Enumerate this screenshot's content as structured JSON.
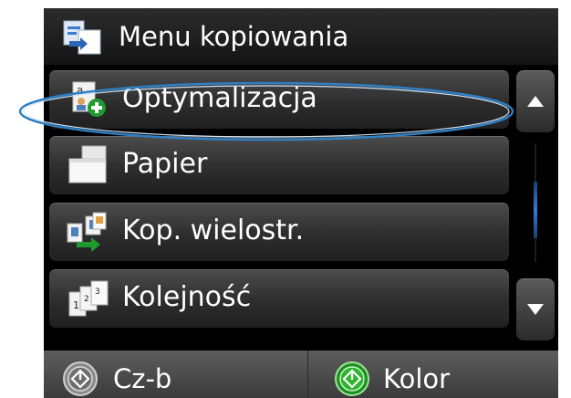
{
  "header": {
    "title": "Menu kopiowania",
    "icon": "copy-icon"
  },
  "menu": {
    "items": [
      {
        "label": "Optymalizacja",
        "icon": "optimize-icon"
      },
      {
        "label": "Papier",
        "icon": "paper-icon"
      },
      {
        "label": "Kop. wielostr.",
        "icon": "multi-page-icon"
      },
      {
        "label": "Kolejność",
        "icon": "collate-icon"
      }
    ]
  },
  "scroll": {
    "up_icon": "arrow-up-icon",
    "down_icon": "arrow-down-icon"
  },
  "footer": {
    "bw_label": "Cz-b",
    "color_label": "Kolor",
    "accent": "#3cc23c"
  }
}
